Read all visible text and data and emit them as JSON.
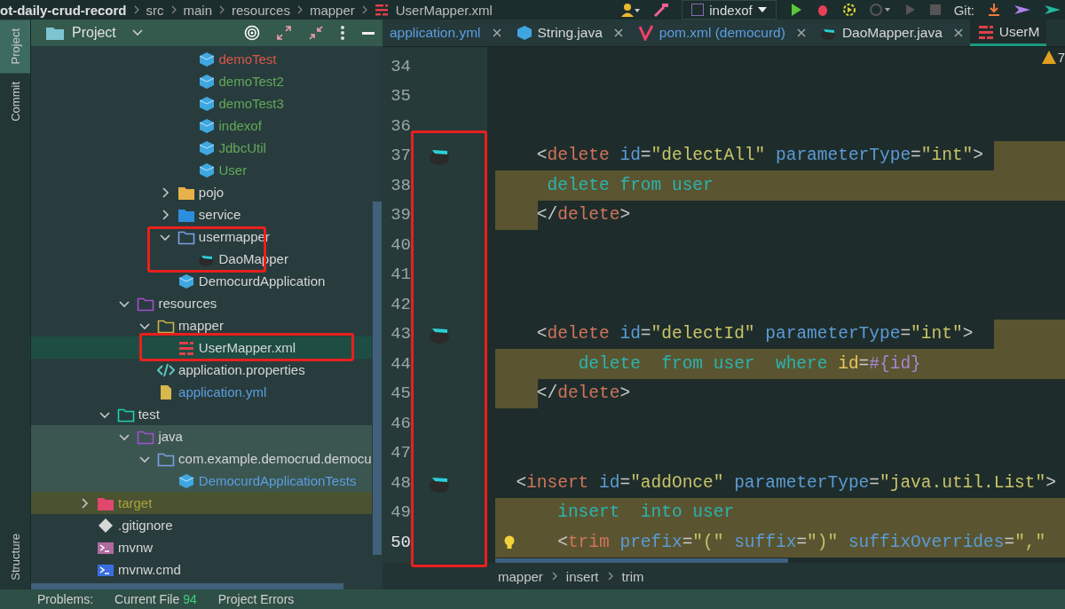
{
  "breadcrumb": [
    "ot-daily-crud-record",
    "src",
    "main",
    "resources",
    "mapper",
    "UserMapper.xml"
  ],
  "toolbar": {
    "run_config": "indexof",
    "git_label": "Git:"
  },
  "side_tabs": [
    {
      "label": "Project",
      "selected": true
    },
    {
      "label": "Commit",
      "selected": false
    }
  ],
  "side_tabs_bottom": [
    {
      "label": "Structure",
      "selected": false
    }
  ],
  "project_panel": {
    "title": "Project"
  },
  "tree": [
    {
      "children": [
        {
          "children": [
            {
              "children": [
                {
                  "children": [
                    {
                      "children": [
                        {
                          "label": "demoTest",
                          "kind": "class",
                          "color": "#d9574a"
                        },
                        {
                          "label": "demoTest2",
                          "kind": "class",
                          "color": "#62a85a"
                        },
                        {
                          "label": "demoTest3",
                          "kind": "class",
                          "color": "#62a85a"
                        },
                        {
                          "label": "indexof",
                          "kind": "class",
                          "color": "#62a85a"
                        },
                        {
                          "label": "JdbcUtil",
                          "kind": "class",
                          "color": "#62a85a"
                        },
                        {
                          "label": "User",
                          "kind": "class",
                          "color": "#62a85a"
                        }
                      ]
                    },
                    {
                      "label": "pojo",
                      "kind": "folder_yellow",
                      "expanded": false
                    },
                    {
                      "label": "service",
                      "kind": "folder_blue",
                      "expanded": false
                    },
                    {
                      "label": "usermapper",
                      "kind": "folder_outline",
                      "expanded": true,
                      "children": [
                        {
                          "label": "DaoMapper",
                          "kind": "bird"
                        }
                      ]
                    },
                    {
                      "label": "DemocurdApplication",
                      "kind": "class"
                    }
                  ]
                }
              ]
            },
            {
              "label": "resources",
              "kind": "folder_purple",
              "expanded": true,
              "children": [
                {
                  "label": "mapper",
                  "kind": "folder_olive",
                  "expanded": true,
                  "children": [
                    {
                      "label": "UserMapper.xml",
                      "kind": "xml",
                      "selected": true
                    }
                  ]
                },
                {
                  "label": "application.properties",
                  "kind": "code"
                },
                {
                  "label": "application.yml",
                  "kind": "file",
                  "color": "#5c9ee0"
                }
              ]
            }
          ]
        },
        {
          "label": "test",
          "kind": "folder_teal",
          "expanded": true,
          "children": [
            {
              "label": "java",
              "kind": "folder_purple",
              "expanded": true,
              "test_scope": true,
              "children": [
                {
                  "label": "com.example.democrud.democu",
                  "kind": "folder_outline",
                  "expanded": true,
                  "test_scope": true,
                  "children": [
                    {
                      "label": "DemocurdApplicationTests",
                      "kind": "class",
                      "color": "#5c9ee0",
                      "test_scope": true
                    }
                  ]
                }
              ]
            }
          ]
        }
      ]
    },
    {
      "label": "target",
      "kind": "folder_pink",
      "expanded": false,
      "excluded": true,
      "color": "#a8a43a"
    },
    {
      "label": ".gitignore",
      "kind": "diamond"
    },
    {
      "label": "mvnw",
      "kind": "terminal"
    },
    {
      "label": "mvnw.cmd",
      "kind": "terminal_blue"
    }
  ],
  "editor_tabs": [
    {
      "label": "application.yml",
      "color": "#5c9ee0",
      "selected": false,
      "closable": true
    },
    {
      "label": "String.java",
      "kind": "class",
      "selected": false,
      "closable": true
    },
    {
      "label": "pom.xml (democurd)",
      "kind": "maven",
      "color": "#5c9ee0",
      "selected": false,
      "closable": true
    },
    {
      "label": "DaoMapper.java",
      "kind": "bird",
      "selected": false,
      "closable": true
    },
    {
      "label": "UserM",
      "kind": "xml",
      "selected": true,
      "closable": false
    }
  ],
  "inspection": {
    "count": "7"
  },
  "code_lines": [
    {
      "number": "34"
    },
    {
      "number": "35"
    },
    {
      "number": "36"
    },
    {
      "number": "37",
      "gutter_mark": true,
      "trailing_highlight": true,
      "tokens": [
        {
          "text": "    <",
          "kind": "punct"
        },
        {
          "text": "delete",
          "kind": "tag"
        },
        {
          "text": " id",
          "kind": "attr"
        },
        {
          "text": "=",
          "kind": "punct"
        },
        {
          "text": "\"delectAll\"",
          "kind": "str"
        },
        {
          "text": " parameterType",
          "kind": "attr"
        },
        {
          "text": "=",
          "kind": "punct"
        },
        {
          "text": "\"int\"",
          "kind": "str"
        },
        {
          "text": ">",
          "kind": "punct"
        }
      ]
    },
    {
      "number": "38",
      "highlighted": true,
      "tokens": [
        {
          "text": "     delete from user",
          "kind": "sql"
        }
      ]
    },
    {
      "number": "39",
      "indent_highlight": true,
      "tokens": [
        {
          "text": "    </",
          "kind": "punct"
        },
        {
          "text": "delete",
          "kind": "tag"
        },
        {
          "text": ">",
          "kind": "punct"
        }
      ]
    },
    {
      "number": "40"
    },
    {
      "number": "41"
    },
    {
      "number": "42"
    },
    {
      "number": "43",
      "gutter_mark": true,
      "trailing_highlight": true,
      "tokens": [
        {
          "text": "    <",
          "kind": "punct"
        },
        {
          "text": "delete",
          "kind": "tag"
        },
        {
          "text": " id",
          "kind": "attr"
        },
        {
          "text": "=",
          "kind": "punct"
        },
        {
          "text": "\"delectId\"",
          "kind": "str"
        },
        {
          "text": " parameterType",
          "kind": "attr"
        },
        {
          "text": "=",
          "kind": "punct"
        },
        {
          "text": "\"int\"",
          "kind": "str"
        },
        {
          "text": ">",
          "kind": "punct"
        }
      ]
    },
    {
      "number": "44",
      "highlighted": true,
      "tokens": [
        {
          "text": "        delete  from user  where ",
          "kind": "sql"
        },
        {
          "text": "id",
          "kind": "prop"
        },
        {
          "text": "=",
          "kind": "punct"
        },
        {
          "text": "#{id}",
          "kind": "param"
        }
      ]
    },
    {
      "number": "45",
      "indent_highlight": true,
      "tokens": [
        {
          "text": "    </",
          "kind": "punct"
        },
        {
          "text": "delete",
          "kind": "tag"
        },
        {
          "text": ">",
          "kind": "punct"
        }
      ]
    },
    {
      "number": "46"
    },
    {
      "number": "47"
    },
    {
      "number": "48",
      "gutter_mark": true,
      "tokens": [
        {
          "text": "  <",
          "kind": "punct"
        },
        {
          "text": "insert",
          "kind": "tag"
        },
        {
          "text": " id",
          "kind": "attr"
        },
        {
          "text": "=",
          "kind": "punct"
        },
        {
          "text": "\"addOnce\"",
          "kind": "str"
        },
        {
          "text": " parameterType",
          "kind": "attr"
        },
        {
          "text": "=",
          "kind": "punct"
        },
        {
          "text": "\"java.util.List\"",
          "kind": "str"
        },
        {
          "text": ">",
          "kind": "punct"
        }
      ]
    },
    {
      "number": "49",
      "highlighted": true,
      "tokens": [
        {
          "text": "      insert  into user",
          "kind": "sql"
        }
      ]
    },
    {
      "number": "50",
      "highlighted": true,
      "current": true,
      "bulb": true,
      "tokens": [
        {
          "text": "      <",
          "kind": "punct"
        },
        {
          "text": "trim",
          "kind": "tag"
        },
        {
          "text": " prefix",
          "kind": "attr"
        },
        {
          "text": "=",
          "kind": "punct"
        },
        {
          "text": "\"(\"",
          "kind": "str"
        },
        {
          "text": " suffix",
          "kind": "attr"
        },
        {
          "text": "=",
          "kind": "punct"
        },
        {
          "text": "\")\"",
          "kind": "str"
        },
        {
          "text": " suffixOverrides",
          "kind": "attr"
        },
        {
          "text": "=",
          "kind": "punct"
        },
        {
          "text": "\",\"",
          "kind": "str"
        }
      ]
    }
  ],
  "editor_breadcrumb": [
    "mapper",
    "insert",
    "trim"
  ],
  "problems_bar": {
    "label": "Problems:",
    "tabs": [
      {
        "label": "Current File",
        "count": "94"
      },
      {
        "label": "Project Errors"
      }
    ]
  }
}
